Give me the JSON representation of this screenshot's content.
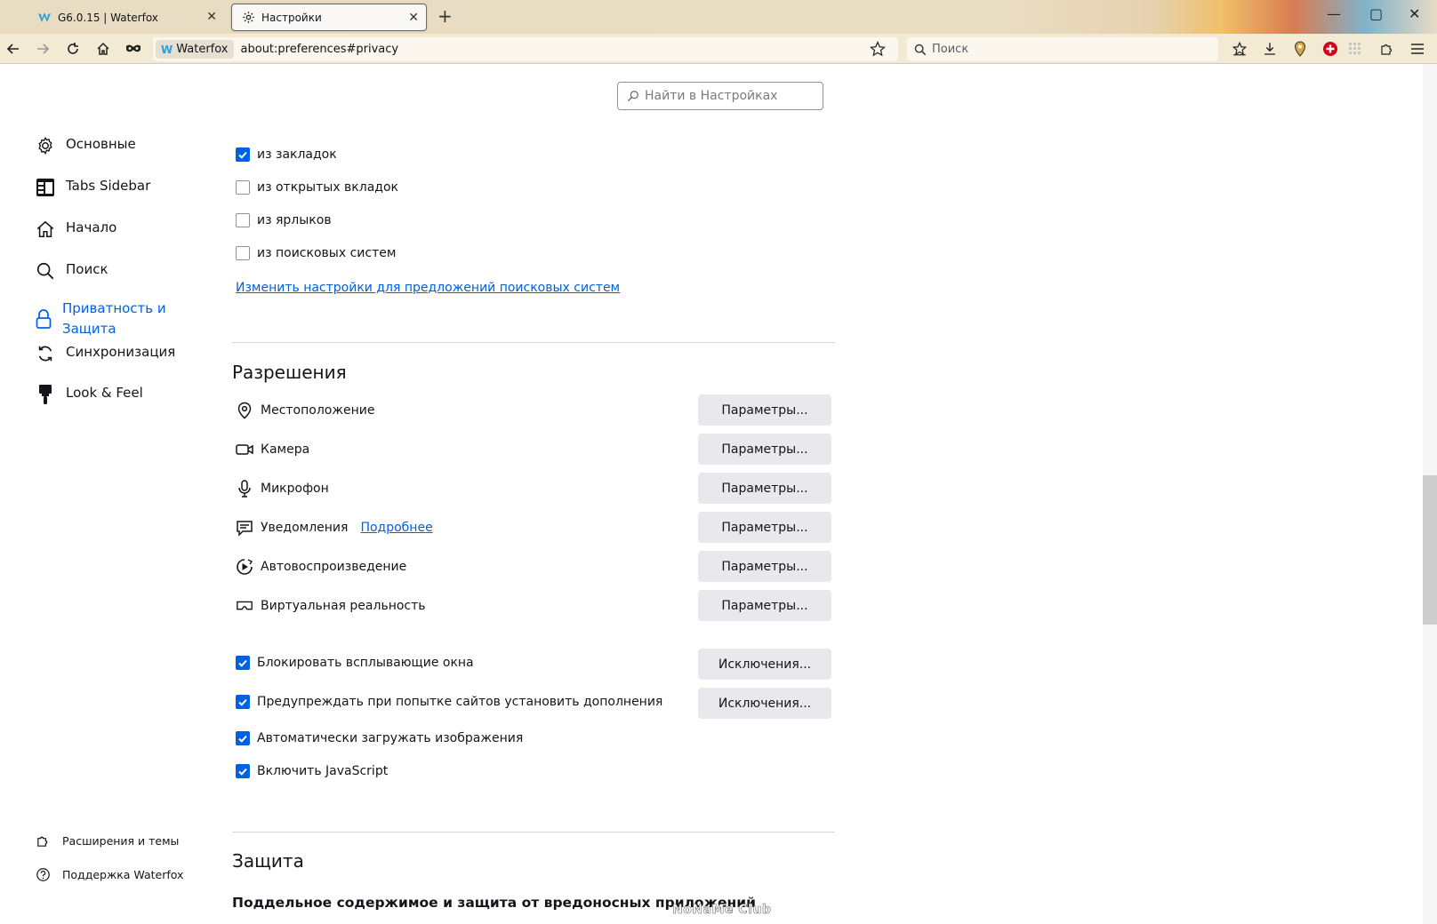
{
  "tabs": [
    {
      "title": "G6.0.15 | Waterfox",
      "close": "✕"
    },
    {
      "title": "Настройки",
      "close": "✕"
    }
  ],
  "newtab": "+",
  "window": {
    "minimize": "—",
    "maximize": "▢",
    "close": "✕"
  },
  "urlbar": {
    "identity": "Waterfox",
    "url": "about:preferences#privacy"
  },
  "search": {
    "placeholder": "Поиск"
  },
  "find": {
    "placeholder": "Найти в Настройках"
  },
  "sidebar": {
    "items": [
      {
        "label": "Основные",
        "icon": "gear-icon"
      },
      {
        "label": "Tabs Sidebar",
        "icon": "tabs-sidebar-icon"
      },
      {
        "label": "Начало",
        "icon": "home-icon"
      },
      {
        "label": "Поиск",
        "icon": "search-icon"
      },
      {
        "label": "Приватность и Защита",
        "icon": "lock-icon"
      },
      {
        "label": "Синхронизация",
        "icon": "sync-icon"
      },
      {
        "label": "Look & Feel",
        "icon": "paintbrush-icon"
      }
    ],
    "footer": [
      {
        "label": "Расширения и темы",
        "icon": "puzzle-icon"
      },
      {
        "label": "Поддержка Waterfox",
        "icon": "help-icon"
      }
    ]
  },
  "suggestions": [
    {
      "label": "из закладок",
      "checked": true
    },
    {
      "label": "из открытых вкладок",
      "checked": false
    },
    {
      "label": "из ярлыков",
      "checked": false
    },
    {
      "label": "из поисковых систем",
      "checked": false
    }
  ],
  "change_suggestions_link": "Изменить настройки для предложений поисковых систем",
  "permissions": {
    "title": "Разрешения",
    "items": [
      {
        "label": "Местоположение",
        "button": "Параметры..."
      },
      {
        "label": "Камера",
        "button": "Параметры..."
      },
      {
        "label": "Микрофон",
        "button": "Параметры..."
      },
      {
        "label": "Уведомления",
        "link": "Подробнее",
        "button": "Параметры..."
      },
      {
        "label": "Автовоспроизведение",
        "button": "Параметры..."
      },
      {
        "label": "Виртуальная реальность",
        "button": "Параметры..."
      }
    ],
    "checks": [
      {
        "label": "Блокировать всплывающие окна",
        "checked": true,
        "button": "Исключения..."
      },
      {
        "label": "Предупреждать при попытке сайтов установить дополнения",
        "checked": true,
        "button": "Исключения..."
      },
      {
        "label": "Автоматически загружать изображения",
        "checked": true
      },
      {
        "label": "Включить JavaScript",
        "checked": true
      }
    ]
  },
  "protection": {
    "title": "Защита",
    "subtitle": "Поддельное содержимое и защита от вредоносных приложений"
  },
  "watermark": "NoNaMe Club",
  "colors": {
    "accent": "#0061e0",
    "button": "#e9e9ed"
  }
}
